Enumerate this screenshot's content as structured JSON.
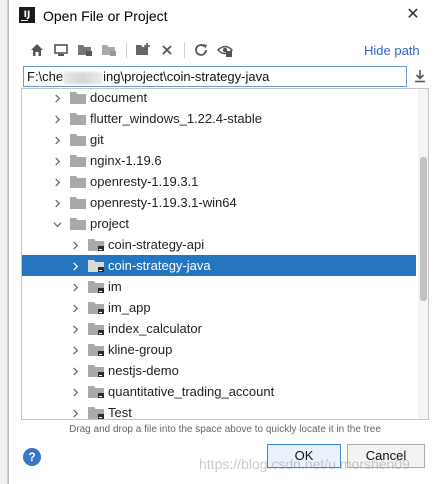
{
  "window": {
    "title": "Open File or Project",
    "app_icon_letters": "IJ",
    "close_glyph": "✕"
  },
  "toolbar": {
    "buttons": [
      "home-icon",
      "desktop-icon",
      "project-folder-icon",
      "module-folder-icon",
      "new-folder-icon",
      "delete-icon",
      "refresh-icon",
      "show-hidden-icon"
    ],
    "hide_path_label": "Hide path"
  },
  "path": {
    "prefix": "F:\\che",
    "suffix": "ing\\project\\coin-strategy-java"
  },
  "tree": {
    "items": [
      {
        "label": "document",
        "level": 0,
        "expanded": false,
        "module": false,
        "selected": false
      },
      {
        "label": "flutter_windows_1.22.4-stable",
        "level": 0,
        "expanded": false,
        "module": false,
        "selected": false
      },
      {
        "label": "git",
        "level": 0,
        "expanded": false,
        "module": false,
        "selected": false
      },
      {
        "label": "nginx-1.19.6",
        "level": 0,
        "expanded": false,
        "module": false,
        "selected": false
      },
      {
        "label": "openresty-1.19.3.1",
        "level": 0,
        "expanded": false,
        "module": false,
        "selected": false
      },
      {
        "label": "openresty-1.19.3.1-win64",
        "level": 0,
        "expanded": false,
        "module": false,
        "selected": false
      },
      {
        "label": "project",
        "level": 0,
        "expanded": true,
        "module": false,
        "selected": false
      },
      {
        "label": "coin-strategy-api",
        "level": 1,
        "expanded": false,
        "module": true,
        "selected": false
      },
      {
        "label": "coin-strategy-java",
        "level": 1,
        "expanded": false,
        "module": true,
        "selected": true
      },
      {
        "label": "im",
        "level": 1,
        "expanded": false,
        "module": true,
        "selected": false
      },
      {
        "label": "im_app",
        "level": 1,
        "expanded": false,
        "module": true,
        "selected": false
      },
      {
        "label": "index_calculator",
        "level": 1,
        "expanded": false,
        "module": true,
        "selected": false
      },
      {
        "label": "kline-group",
        "level": 1,
        "expanded": false,
        "module": true,
        "selected": false
      },
      {
        "label": "nestjs-demo",
        "level": 1,
        "expanded": false,
        "module": true,
        "selected": false
      },
      {
        "label": "quantitative_trading_account",
        "level": 1,
        "expanded": false,
        "module": true,
        "selected": false
      },
      {
        "label": "Test",
        "level": 1,
        "expanded": false,
        "module": true,
        "selected": false
      }
    ]
  },
  "footer": {
    "hint": "Drag and drop a file into the space above to quickly locate it in the tree",
    "help_label": "?",
    "ok_label": "OK",
    "cancel_label": "Cancel",
    "watermark": "https://blog.csdn.net/u.morshen09"
  },
  "colors": {
    "selection": "#2675bf",
    "link": "#2f65ca",
    "folder": "#a9a9a9"
  }
}
